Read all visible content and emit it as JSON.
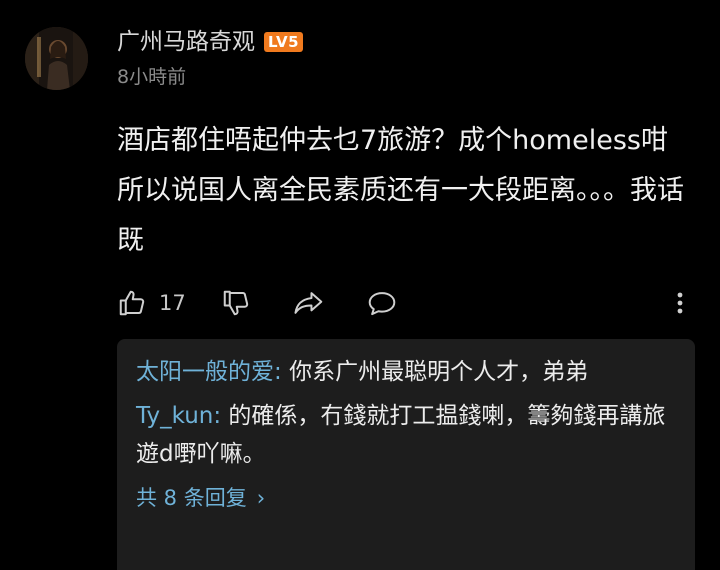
{
  "comment": {
    "author": "广州马路奇观",
    "level_badge": "LV5",
    "time": "8小時前",
    "text": "酒店都住唔起仲去乜7旅游？成个homeless咁 所以说国人离全民素质还有一大段距离。。。我话既",
    "likes": "17"
  },
  "icons": {
    "like": "thumbs-up-icon",
    "dislike": "thumbs-down-icon",
    "share": "share-icon",
    "reply": "comment-bubble-icon",
    "more": "more-vertical-icon"
  },
  "replies": {
    "items": [
      {
        "name": "太阳一般的爱",
        "sep": ": ",
        "text": "你系广州最聪明个人才，弟弟"
      },
      {
        "name": "Ty_kun",
        "sep": ": ",
        "text": "的確係，冇錢就打工揾錢喇，籌夠錢再講旅遊d嘢吖嘛。"
      }
    ],
    "more_label": "共 8 条回复",
    "more_chevron": "›"
  },
  "colors": {
    "background": "#000000",
    "reply_panel": "#1d1d1d",
    "link": "#6fb2d8",
    "badge": "#f07a1e",
    "muted": "#8b8b8b"
  }
}
